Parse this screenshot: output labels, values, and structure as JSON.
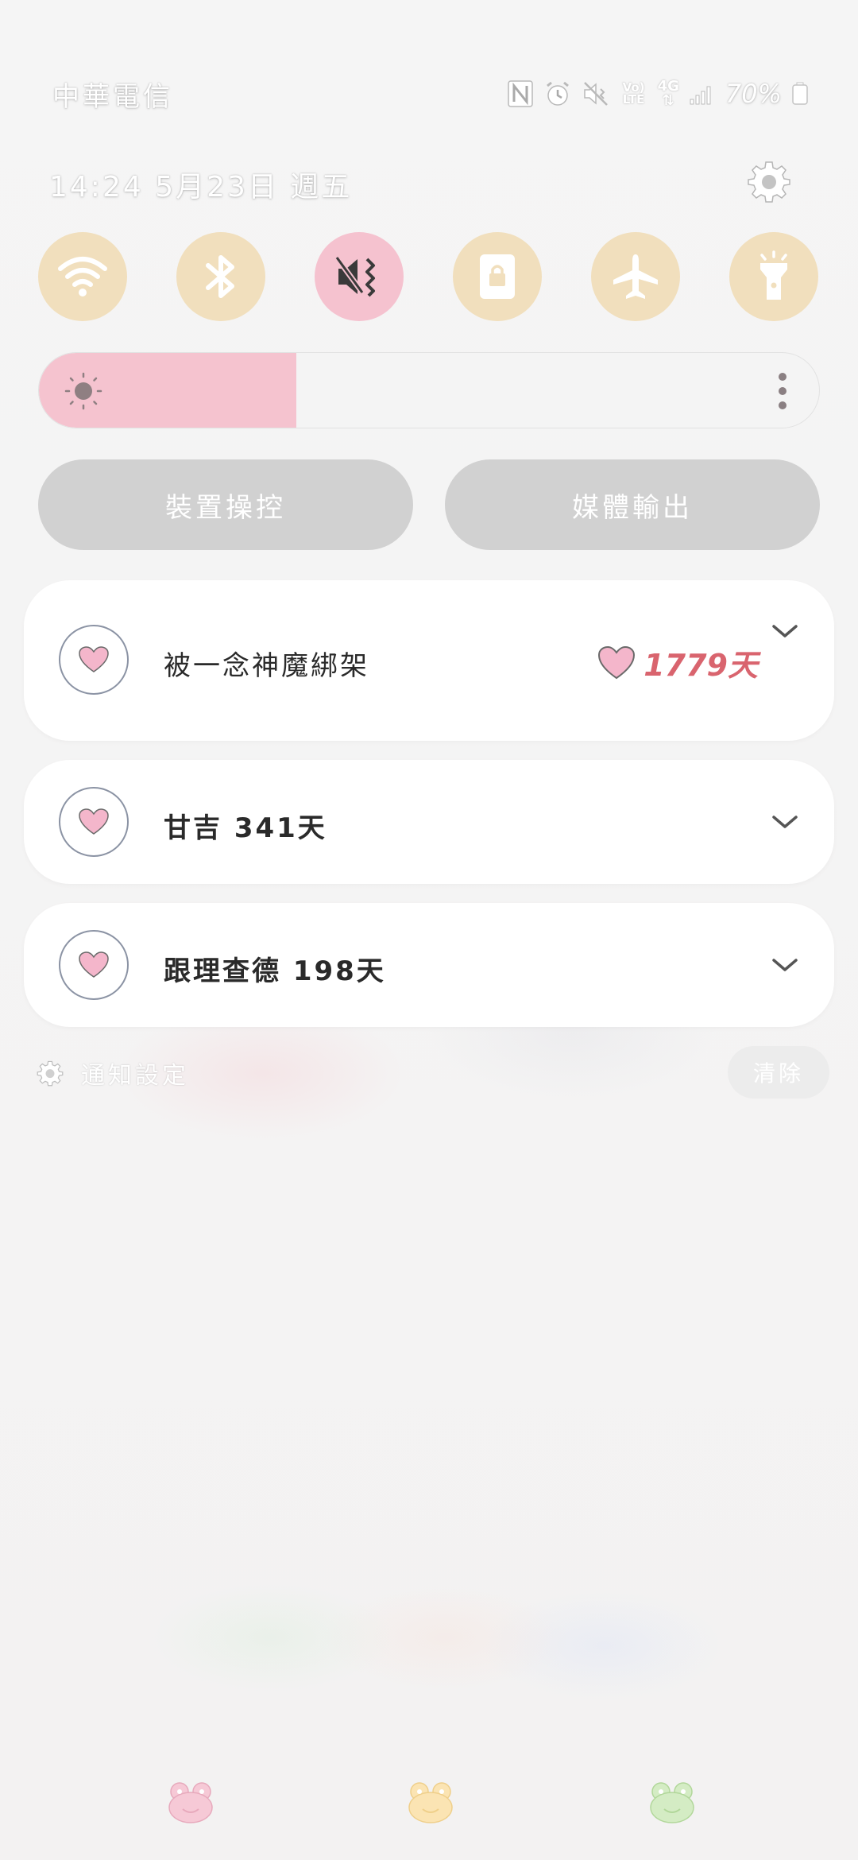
{
  "status_bar": {
    "carrier": "中華電信",
    "battery_percent": "70%",
    "icons": [
      "nfc-icon",
      "alarm-icon",
      "mute-icon",
      "volte-icon",
      "4g-data-icon",
      "signal-icon",
      "battery-icon"
    ],
    "volte_label": "Vo) LTE",
    "network_label": "4G"
  },
  "header": {
    "datetime": "14:24  5月23日  週五",
    "settings_icon": "gear-icon"
  },
  "quick_toggles": [
    {
      "name": "wifi",
      "icon": "wifi-icon",
      "active": false
    },
    {
      "name": "bluetooth",
      "icon": "bluetooth-icon",
      "active": false
    },
    {
      "name": "sound",
      "icon": "mute-vibrate-icon",
      "active": true
    },
    {
      "name": "rotation-lock",
      "icon": "rotation-lock-icon",
      "active": false
    },
    {
      "name": "airplane-mode",
      "icon": "airplane-icon",
      "active": false
    },
    {
      "name": "flashlight",
      "icon": "flashlight-icon",
      "active": false
    }
  ],
  "brightness": {
    "level": 0.33,
    "icon": "sun-icon",
    "more_icon": "more-vertical-icon"
  },
  "buttons": {
    "device_control": "裝置操控",
    "media_output": "媒體輸出"
  },
  "notifications": [
    {
      "title": "被一念神魔綁架",
      "days": "1779天",
      "icon": "heart-icon"
    },
    {
      "title": "甘吉 341天",
      "icon": "heart-icon"
    },
    {
      "title": "跟理查德 198天",
      "icon": "heart-icon"
    }
  ],
  "footer": {
    "notification_settings": "通知設定",
    "clear": "清除"
  },
  "colors": {
    "toggle_inactive": "#f1dfbd",
    "toggle_active": "#f5c2cf",
    "brightness_fill": "#f5c3cf",
    "pill_button": "#d1d1d1",
    "days_text": "#d9646e",
    "heart_pink": "#f4b6cb"
  },
  "dock": [
    "frog-pink-icon",
    "frog-yellow-icon",
    "frog-green-icon"
  ]
}
